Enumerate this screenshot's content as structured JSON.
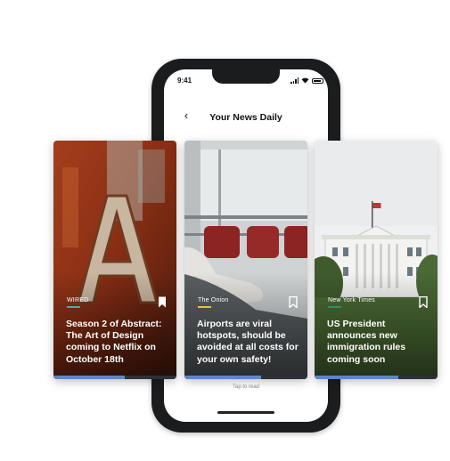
{
  "status_bar": {
    "time": "9:41"
  },
  "header": {
    "title": "Your News Daily"
  },
  "icons": {
    "back": "chevron-left-icon",
    "bookmark": "bookmark-icon"
  },
  "colors": {
    "progress": "#5b87c7",
    "wired_accent": "#36b7a5",
    "onion_accent": "#e2c048",
    "nyt_accent": "#2e8f6a"
  },
  "cards": [
    {
      "source": "WIRED",
      "headline": "Season 2 of Abstract: The Art of Design coming to Netflix on October 18th",
      "progress": 0.58
    },
    {
      "source": "The Onion",
      "headline": "Airports are viral hotspots, should be avoided at all costs for your own safety!",
      "progress": 0.62
    },
    {
      "source": "New York Times",
      "headline": "US President announces new immigration rules coming soon",
      "progress": 0.68
    }
  ],
  "footer": {
    "hint": "Tap to read"
  }
}
